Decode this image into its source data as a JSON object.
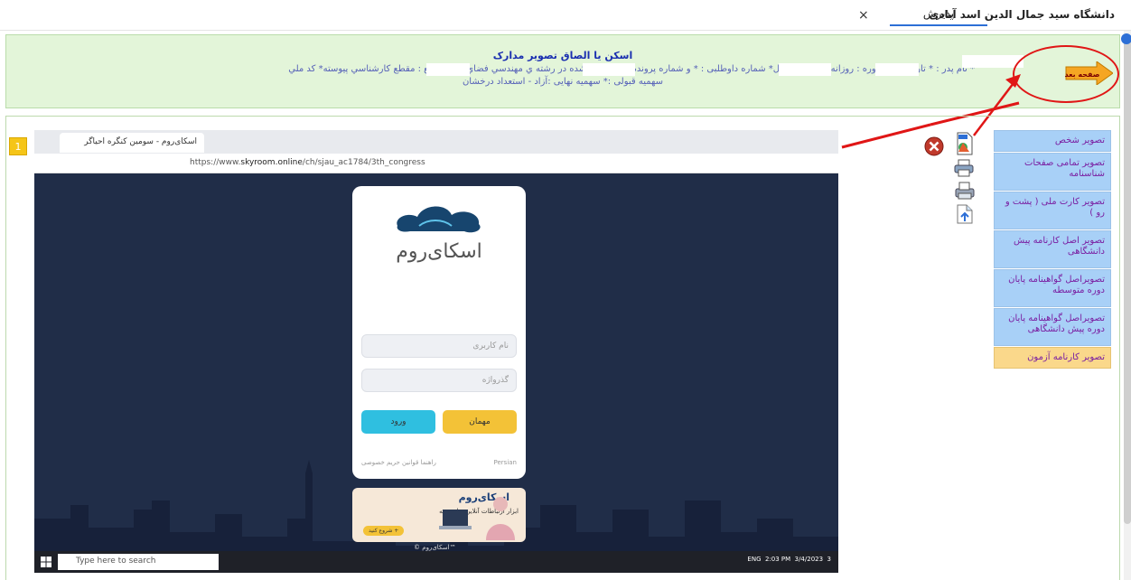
{
  "topbar": {
    "university": "دانشگاه سید جمال الدین اسد آبادی",
    "tab": "پذیرش",
    "close": "×"
  },
  "header": {
    "title": "اسکن یا الصاق تصویر مدارک",
    "line1": "* نام پدر : * تاریخ تولد * دوره : روزانه* نیم سال :اول* شماره داوطلبی : * و شماره پرونده : * پذیرفته شده در رشته ي مهندسي فضاي سبز مقطع : مقطع کارشناسي پیوسته* کد ملي",
    "line2": "سهمیه قبولی :* سهمیه نهایی :آزاد - استعداد درخشان",
    "next_label": "صفحه بعد"
  },
  "sidebar": {
    "items": [
      {
        "label": "تصویر شخص"
      },
      {
        "label": "تصویر تمامی صفحات شناسنامه"
      },
      {
        "label": "تصویر کارت ملی ( پشت و رو )"
      },
      {
        "label": "تصویر اصل کارنامه پیش دانشگاهی"
      },
      {
        "label": "تصویراصل گواهینامه پایان دوره متوسطه"
      },
      {
        "label": "تصویراصل گواهینامه پایان دوره پیش دانشگاهی"
      },
      {
        "label": "تصویر کارنامه آزمون"
      }
    ]
  },
  "image": {
    "badge": "1",
    "browser_tab": "اسکای‌روم - سومین کنگره احیاگر",
    "url_prefix": "https://www.",
    "url_host": "skyroom.online",
    "url_path": "/ch/sjau_ac1784/3th_congress",
    "logo_text": "اسکای‌روم",
    "username_placeholder": "نام کاربری",
    "password_placeholder": "گذرواژه",
    "guest_button": "مهمان",
    "login_button": "ورود",
    "footer_lang": "Persian",
    "footer_links": "راهنما  قوانین  حریم خصوصی",
    "banner_title": "اسکای‌روم",
    "banner_sub": "ابزار ارتباطات آنلاین برای همه",
    "banner_btn": "شروع کنید +",
    "copyright": "© اسکای‌روم™",
    "taskbar_search": "Type here to search",
    "taskbar_time": "2:03 PM",
    "taskbar_date": "3/4/2023",
    "taskbar_lang": "ENG",
    "notify_count": "3"
  },
  "colors": {
    "header_bg": "#e3f5d9",
    "sidebar_item": "#a8d0f7",
    "sidebar_active": "#fad88b",
    "annotation_red": "#e01616",
    "next_arrow": "#f5a623"
  }
}
